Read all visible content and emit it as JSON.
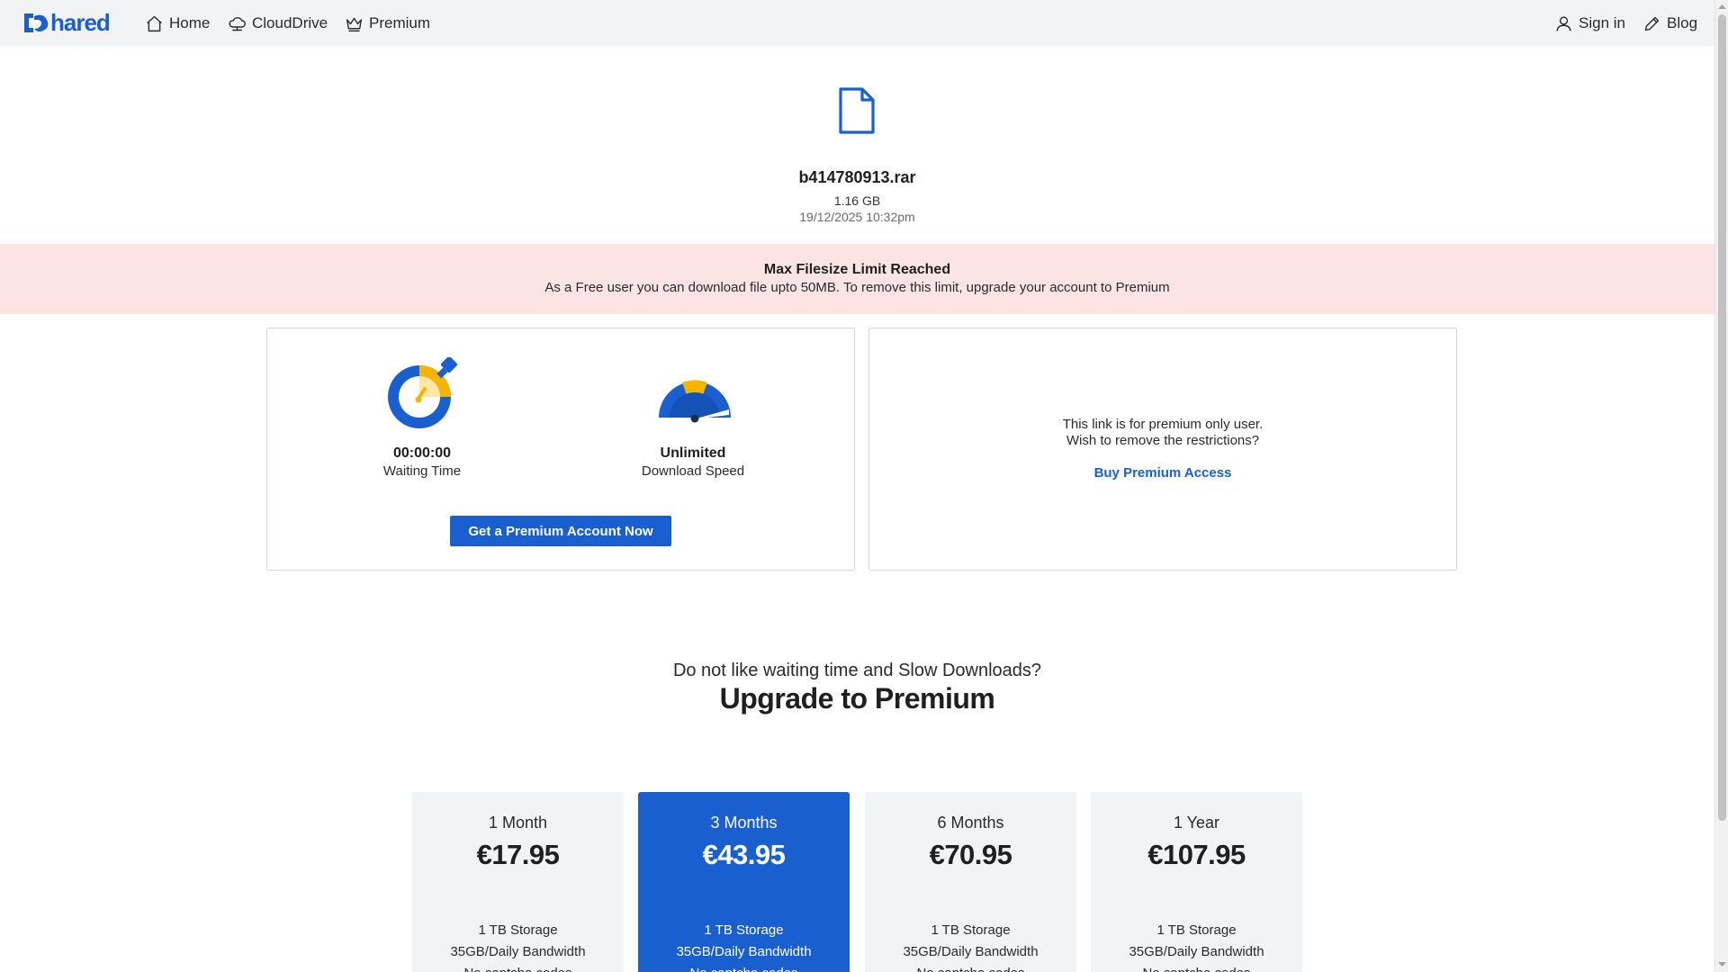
{
  "nav": {
    "logo_text": "hared",
    "items": [
      {
        "label": "Home",
        "icon": "home-icon"
      },
      {
        "label": "CloudDrive",
        "icon": "cloud-icon"
      },
      {
        "label": "Premium",
        "icon": "crown-icon"
      }
    ],
    "right": [
      {
        "label": "Sign in",
        "icon": "user-icon"
      },
      {
        "label": "Blog",
        "icon": "pencil-icon"
      }
    ]
  },
  "file": {
    "icon": "file-icon",
    "name": "b414780913.rar",
    "size": "1.16 GB",
    "date": "19/12/2025 10:32pm"
  },
  "alert": {
    "title": "Max Filesize Limit Reached",
    "message": "As a Free user you can download file upto 50MB. To remove this limit, upgrade your account to Premium"
  },
  "stats": {
    "wait": {
      "value": "00:00:00",
      "label": "Waiting Time",
      "icon": "stopwatch-icon"
    },
    "speed": {
      "value": "Unlimited",
      "label": "Download Speed",
      "icon": "speedometer-icon"
    }
  },
  "cta_label": "Get a Premium Account Now",
  "premium_only": {
    "line1": "This link is for premium only user.",
    "line2": "Wish to remove the restrictions?",
    "link": "Buy Premium Access"
  },
  "upsell": {
    "subtitle": "Do not like waiting time and Slow Downloads?",
    "title": "Upgrade to Premium"
  },
  "plans": [
    {
      "name": "1 Month",
      "price": "€17.95",
      "features": [
        "1 TB Storage",
        "35GB/Daily Bandwidth",
        "No captcha codes"
      ],
      "featured": false
    },
    {
      "name": "3 Months",
      "price": "€43.95",
      "features": [
        "1 TB Storage",
        "35GB/Daily Bandwidth",
        "No captcha codes"
      ],
      "featured": true
    },
    {
      "name": "6 Months",
      "price": "€70.95",
      "features": [
        "1 TB Storage",
        "35GB/Daily Bandwidth",
        "No captcha codes"
      ],
      "featured": false
    },
    {
      "name": "1 Year",
      "price": "€107.95",
      "features": [
        "1 TB Storage",
        "35GB/Daily Bandwidth",
        "No captcha codes"
      ],
      "featured": false
    }
  ],
  "colors": {
    "brand": "#1a5fd0",
    "accent": "#f5b400",
    "nav_bg": "#f1f3f4",
    "alert_bg": "#fde4e4"
  }
}
